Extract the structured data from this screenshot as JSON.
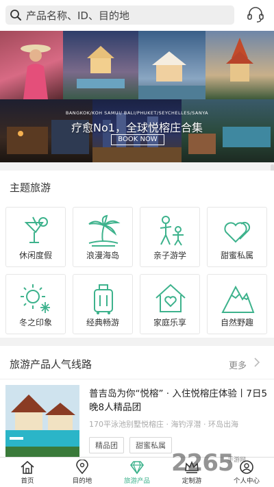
{
  "search": {
    "placeholder": "产品名称、ID、目的地"
  },
  "banner": {
    "caption": "BANGKOK/KOH SAMUI/ BALI/PHUKET/SEYCHELLES/SANYA",
    "title": "疗愈No1，全球悦榕庄合集",
    "button": "BOOK NOW"
  },
  "themes": {
    "title": "主题旅游",
    "items": [
      {
        "label": "休闲度假",
        "icon": "cocktail-icon"
      },
      {
        "label": "浪漫海岛",
        "icon": "palm-tree-icon"
      },
      {
        "label": "亲子游学",
        "icon": "parent-child-icon"
      },
      {
        "label": "甜蜜私属",
        "icon": "hearts-icon"
      },
      {
        "label": "冬之印象",
        "icon": "sun-snowflake-icon"
      },
      {
        "label": "经典畅游",
        "icon": "luggage-icon"
      },
      {
        "label": "家庭乐享",
        "icon": "house-heart-icon"
      },
      {
        "label": "自然野趣",
        "icon": "mountain-icon"
      }
    ],
    "accent": "#3db28c"
  },
  "popular": {
    "title": "旅游产品人气线路",
    "more": "更多",
    "product": {
      "title": "普吉岛为你“悦榕” · 入住悦榕庄体验丨7日5晚8人精品团",
      "subtitle": "170平泳池别墅悦榕庄 · 海钓浮潜 · 环岛出海",
      "tags": [
        "精品团",
        "甜蜜私属"
      ]
    }
  },
  "nav": {
    "items": [
      {
        "label": "首页",
        "icon": "home-icon"
      },
      {
        "label": "目的地",
        "icon": "location-pin-icon"
      },
      {
        "label": "旅游产品",
        "icon": "diamond-icon"
      },
      {
        "label": "定制游",
        "icon": "crown-icon"
      },
      {
        "label": "个人中心",
        "icon": "user-icon"
      }
    ]
  },
  "watermark": {
    "text": "2265",
    "sub": "手游网"
  }
}
